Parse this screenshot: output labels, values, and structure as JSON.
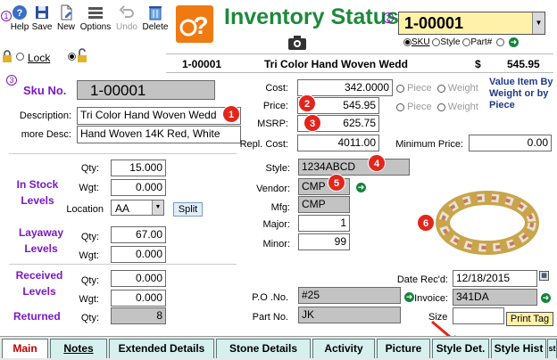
{
  "toolbar": {
    "help": "Help",
    "save": "Save",
    "new": "New",
    "options": "Options",
    "undo": "Undo",
    "delete": "Delete",
    "lock": "Lock",
    "step1": "1",
    "step2": "2",
    "step3": "3"
  },
  "header": {
    "title": "Inventory Status",
    "selected_sku": "1-00001",
    "search_by": [
      "SKU",
      "Style",
      "Part#"
    ],
    "banner_sku": "1-00001",
    "banner_desc": "Tri Color Hand Woven Wedd",
    "banner_currency": "$",
    "banner_price": "545.95"
  },
  "item": {
    "sku_label": "Sku No.",
    "sku": "1-00001",
    "description_label": "Description:",
    "description": "Tri Color Hand Woven Wedd",
    "more_desc_label": "more Desc:",
    "more_desc": "Hand Woven 14K Red, White"
  },
  "pricing": {
    "cost_label": "Cost:",
    "cost": "342.0000",
    "price_label": "Price:",
    "price": "545.95",
    "msrp_label": "MSRP:",
    "msrp": "625.75",
    "repl_label": "Repl. Cost:",
    "repl_cost": "4011.00",
    "piece": "Piece",
    "weight": "Weight",
    "value_note": "Value Item By Weight or by Piece",
    "min_price_label": "Minimum Price:",
    "min_price": "0.00"
  },
  "stock": {
    "in_stock_label": "In Stock Levels",
    "qty_label": "Qty:",
    "wgt_label": "Wgt:",
    "qty": "15.000",
    "wgt": "0.000",
    "location_label": "Location",
    "location": "AA",
    "split": "Split",
    "layaway_label": "Layaway Levels",
    "layaway_qty": "67.00",
    "layaway_wgt": "0.000",
    "received_label": "Received Levels",
    "received_qty": "0.000",
    "received_wgt": "0.000",
    "returned_label": "Returned",
    "returned_qty": "8"
  },
  "details": {
    "style_label": "Style:",
    "style": "1234ABCD",
    "vendor_label": "Vendor:",
    "vendor": "CMP",
    "mfg_label": "Mfg:",
    "mfg": "CMP",
    "major_label": "Major:",
    "major": "1",
    "minor_label": "Minor:",
    "minor": "99",
    "date_label": "Date Rec'd:",
    "date": "12/18/2015",
    "po_label": "P.O .No.",
    "po": "#25",
    "invoice_label": "Invoice:",
    "invoice": "341DA",
    "part_label": "Part No.",
    "part": "JK",
    "size_label": "Size",
    "print_tag": "Print Tag"
  },
  "badges": [
    "1",
    "2",
    "3",
    "4",
    "5",
    "6"
  ],
  "tabs": [
    "Main",
    "Notes",
    "Extended Details",
    "Stone Details",
    "Activity",
    "Picture",
    "Style Det.",
    "Style Hist",
    "st"
  ],
  "colors": {
    "title_green": "#1d8a3a",
    "label_purple": "#7a18c6",
    "badge_red": "#e3261b",
    "tab_teal": "#d6f0ef"
  }
}
